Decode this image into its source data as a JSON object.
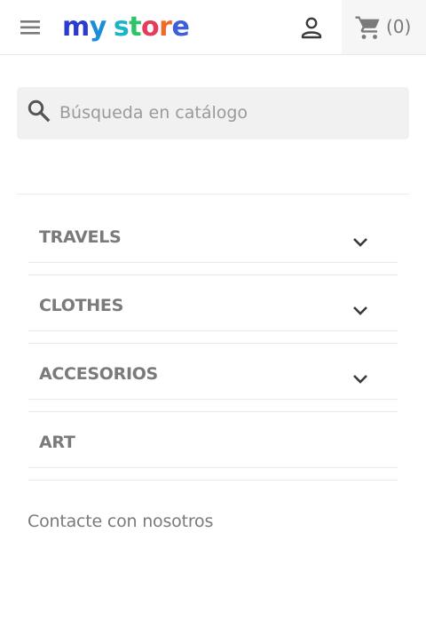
{
  "header": {
    "logo": {
      "letters": [
        {
          "char": "m",
          "color": "#2b3bd0"
        },
        {
          "char": "y",
          "color": "#1a8fd8"
        },
        {
          "char": " ",
          "color": "#ffffff"
        },
        {
          "char": "s",
          "color": "#19b5c8"
        },
        {
          "char": "t",
          "color": "#2ec26a"
        },
        {
          "char": "o",
          "color": "#e23d5b"
        },
        {
          "char": "r",
          "color": "#f26a2a"
        },
        {
          "char": "e",
          "color": "#3d5fd8"
        }
      ]
    },
    "menu_icon": "hamburger-icon",
    "account_icon": "user-icon",
    "cart": {
      "icon": "shopping-cart-icon",
      "count_label": "(0)"
    }
  },
  "search": {
    "icon": "search-icon",
    "placeholder": "Búsqueda en catálogo",
    "value": ""
  },
  "categories": [
    {
      "label": "TRAVELS",
      "expandable": true
    },
    {
      "label": "CLOTHES",
      "expandable": true
    },
    {
      "label": "ACCESORIOS",
      "expandable": true
    },
    {
      "label": "ART",
      "expandable": false
    }
  ],
  "contact_link": "Contacte con nosotros",
  "colors": {
    "text": "#7a7a7a",
    "search_bg": "#f1f1f1",
    "cart_bg": "#f6f6f6",
    "divider": "#e9e9e9"
  }
}
